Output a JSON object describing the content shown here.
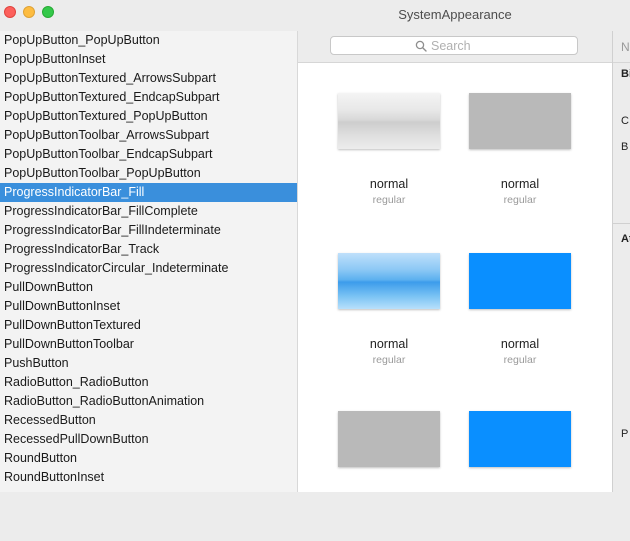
{
  "window": {
    "title": "SystemAppearance"
  },
  "sidebar": {
    "items": [
      "PopUpButton_PopUpButton",
      "PopUpButtonInset",
      "PopUpButtonTextured_ArrowsSubpart",
      "PopUpButtonTextured_EndcapSubpart",
      "PopUpButtonTextured_PopUpButton",
      "PopUpButtonToolbar_ArrowsSubpart",
      "PopUpButtonToolbar_EndcapSubpart",
      "PopUpButtonToolbar_PopUpButton",
      "ProgressIndicatorBar_Fill",
      "ProgressIndicatorBar_FillComplete",
      "ProgressIndicatorBar_FillIndeterminate",
      "ProgressIndicatorBar_Track",
      "ProgressIndicatorCircular_Indeterminate",
      "PullDownButton",
      "PullDownButtonInset",
      "PullDownButtonTextured",
      "PullDownButtonToolbar",
      "PushButton",
      "RadioButton_RadioButton",
      "RadioButton_RadioButtonAnimation",
      "RecessedButton",
      "RecessedPullDownButton",
      "RoundButton",
      "RoundButtonInset"
    ],
    "selected": "ProgressIndicatorBar_Fill"
  },
  "search": {
    "placeholder": "Search",
    "value": ""
  },
  "grid": {
    "cells": [
      {
        "swatch": "aqua-gray",
        "label": "normal",
        "sublabel": "regular"
      },
      {
        "swatch": "gray-box",
        "label": "normal",
        "sublabel": "regular"
      },
      {
        "swatch": "aqua-blue",
        "label": "normal",
        "sublabel": "regular"
      },
      {
        "swatch": "blue-box",
        "label": "normal",
        "sublabel": "regular"
      },
      {
        "swatch": "gray-box",
        "label": "",
        "sublabel": ""
      },
      {
        "swatch": "blue-box",
        "label": "",
        "sublabel": ""
      }
    ]
  },
  "inspector": {
    "header": "N",
    "texts": [
      "Bi",
      "C",
      "B",
      "At",
      "P"
    ]
  },
  "colors": {
    "selection": "#3a8fdc",
    "blue_fill": "#0a8fff",
    "gray_fill": "#b9b9b9"
  }
}
